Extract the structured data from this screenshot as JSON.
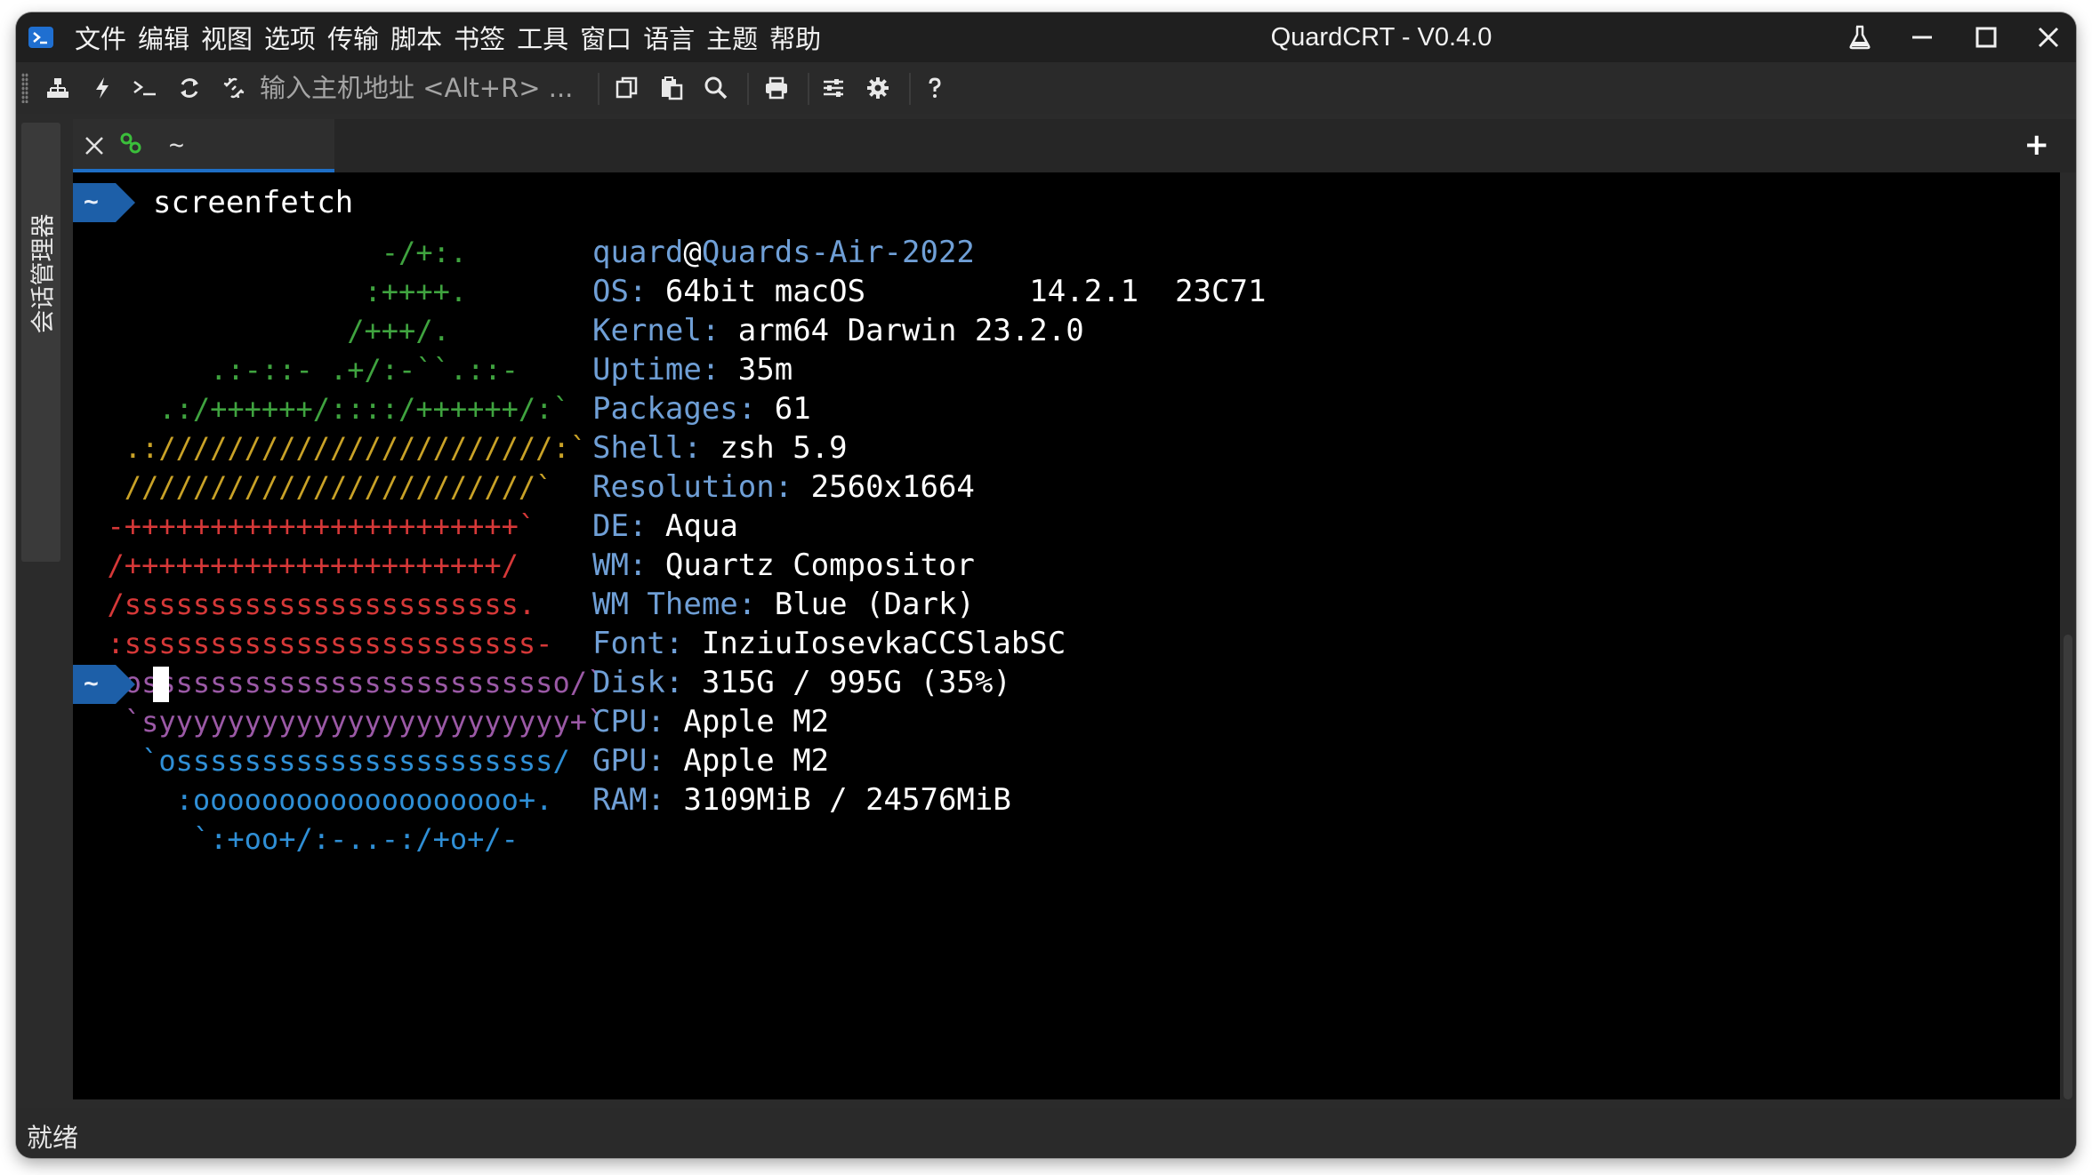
{
  "window": {
    "title": "QuardCRT - V0.4.0",
    "menu": [
      "文件",
      "编辑",
      "视图",
      "选项",
      "传输",
      "脚本",
      "书签",
      "工具",
      "窗口",
      "语言",
      "主题",
      "帮助"
    ]
  },
  "toolbar": {
    "host_placeholder": "输入主机地址 <Alt+R> ..."
  },
  "sidepanel": {
    "label": "会话管理器"
  },
  "tabs": [
    {
      "label": "~",
      "active": true
    }
  ],
  "terminal": {
    "prompt_symbol": "~",
    "command": "screenfetch",
    "logo_lines": [
      {
        "text": "                  -/+:.",
        "color": "#3fa33f"
      },
      {
        "text": "                 :++++.",
        "color": "#3fa33f"
      },
      {
        "text": "                /+++/.",
        "color": "#3fa33f"
      },
      {
        "text": "        .:-::- .+/:-``.::-",
        "color": "#3fa33f"
      },
      {
        "text": "     .:/++++++/::::/++++++/:`",
        "color": "#3fa33f"
      },
      {
        "text": "   .:///////////////////////:`",
        "color": "#c9a227"
      },
      {
        "text": "   ////////////////////////`",
        "color": "#c9a227"
      },
      {
        "text": "  -+++++++++++++++++++++++`",
        "color": "#d63838"
      },
      {
        "text": "  /++++++++++++++++++++++/",
        "color": "#d63838"
      },
      {
        "text": "  /sssssssssssssssssssssss.",
        "color": "#d63838"
      },
      {
        "text": "  :ssssssssssssssssssssssss-",
        "color": "#d63838"
      },
      {
        "text": "   osssssssssssssssssssssssso/`",
        "color": "#9b59a6"
      },
      {
        "text": "   `syyyyyyyyyyyyyyyyyyyyyyyy+`",
        "color": "#9b59a6"
      },
      {
        "text": "    `ossssssssssssssssssssss/",
        "color": "#2f8fd6"
      },
      {
        "text": "      :ooooooooooooooooooo+.",
        "color": "#2f8fd6"
      },
      {
        "text": "       `:+oo+/:-..-:/+o+/-",
        "color": "#2f8fd6"
      }
    ],
    "user": "quard",
    "at": "@",
    "host": "Quards-Air-2022",
    "info": [
      {
        "key": "OS:",
        "value": "64bit macOS         14.2.1  23C71"
      },
      {
        "key": "Kernel:",
        "value": "arm64 Darwin 23.2.0"
      },
      {
        "key": "Uptime:",
        "value": "35m"
      },
      {
        "key": "Packages:",
        "value": "61"
      },
      {
        "key": "Shell:",
        "value": "zsh 5.9"
      },
      {
        "key": "Resolution:",
        "value": "2560x1664"
      },
      {
        "key": "DE:",
        "value": "Aqua"
      },
      {
        "key": "WM:",
        "value": "Quartz Compositor"
      },
      {
        "key": "WM Theme:",
        "value": "Blue (Dark)"
      },
      {
        "key": "Font:",
        "value": "InziuIosevkaCCSlabSC"
      },
      {
        "key": "Disk:",
        "value": "315G / 995G (35%)"
      },
      {
        "key": "CPU:",
        "value": "Apple M2"
      },
      {
        "key": "GPU:",
        "value": "Apple M2"
      },
      {
        "key": "RAM:",
        "value": "3109MiB / 24576MiB"
      }
    ]
  },
  "status": {
    "text": "就绪"
  },
  "colors": {
    "prompt_blue": "#1d5fa8",
    "info_key": "#6f9fd6",
    "tab_underline": "#1e6ec5"
  }
}
